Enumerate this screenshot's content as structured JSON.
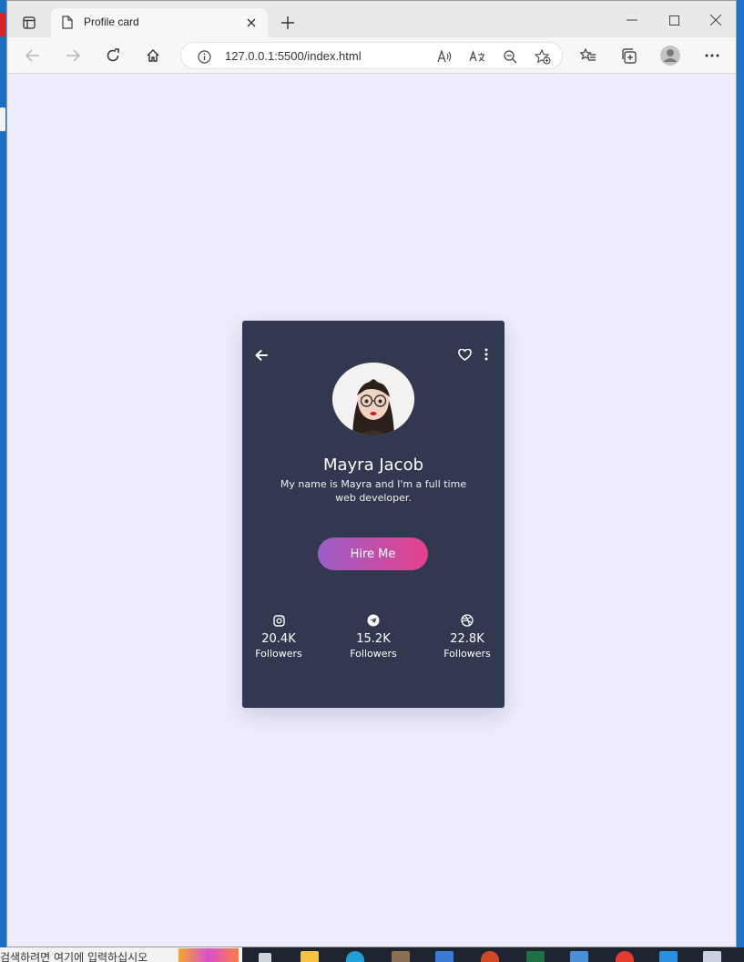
{
  "browser": {
    "tab_title": "Profile card",
    "url_host": "127.0.0.1",
    "url_rest": ":5500/index.html"
  },
  "card": {
    "name": "Mayra Jacob",
    "bio": "My name is Mayra and I'm a full time web developer.",
    "button": "Hire Me",
    "stats": [
      {
        "icon": "instagram-icon",
        "value": "20.4K",
        "label": "Followers"
      },
      {
        "icon": "telegram-icon",
        "value": "15.2K",
        "label": "Followers"
      },
      {
        "icon": "dribbble-icon",
        "value": "22.8K",
        "label": "Followers"
      }
    ]
  },
  "taskbar": {
    "search_text": "검색하려면 여기에 입력하십시오"
  },
  "colors": {
    "card_bg": "#32384f",
    "page_bg": "#eeedfd",
    "button_gradient_start": "#9b5fc9",
    "button_gradient_end": "#e4418b"
  }
}
